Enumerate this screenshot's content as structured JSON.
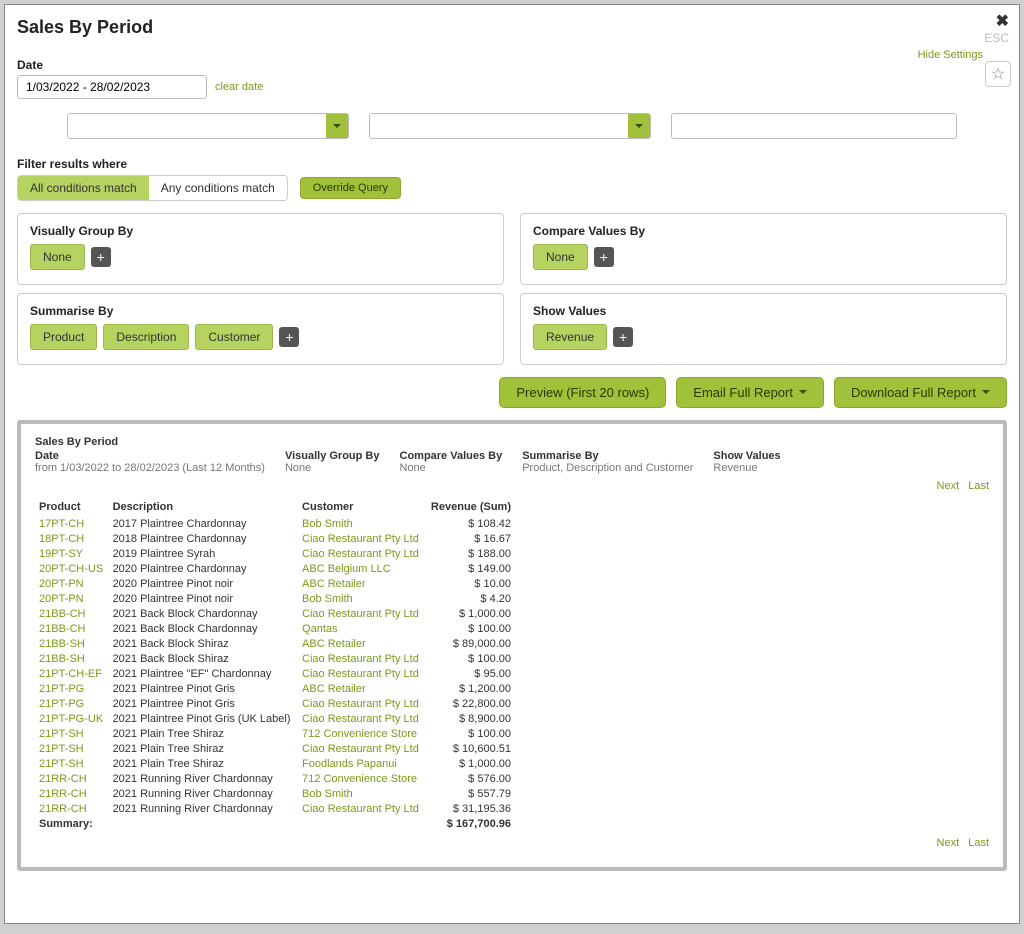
{
  "title": "Sales By Period",
  "close": "✖",
  "esc": "ESC",
  "hideSettings": "Hide Settings",
  "star": "☆",
  "dateLabel": "Date",
  "dateValue": "1/03/2022 - 28/02/2023",
  "clearDate": "clear date",
  "filterLabel": "Filter results where",
  "condAll": "All conditions match",
  "condAny": "Any conditions match",
  "override": "Override Query",
  "panels": {
    "visuallyGroupBy": {
      "title": "Visually Group By",
      "chips": [
        "None"
      ]
    },
    "compareValuesBy": {
      "title": "Compare Values By",
      "chips": [
        "None"
      ]
    },
    "summariseBy": {
      "title": "Summarise By",
      "chips": [
        "Product",
        "Description",
        "Customer"
      ]
    },
    "showValues": {
      "title": "Show Values",
      "chips": [
        "Revenue"
      ]
    }
  },
  "preview": "Preview (First 20 rows)",
  "emailReport": "Email Full Report",
  "downloadReport": "Download Full Report",
  "report": {
    "title": "Sales By Period",
    "meta": [
      {
        "label": "Date",
        "value": "from 1/03/2022 to 28/02/2023 (Last 12 Months)"
      },
      {
        "label": "Visually Group By",
        "value": "None"
      },
      {
        "label": "Compare Values By",
        "value": "None"
      },
      {
        "label": "Summarise By",
        "value": "Product, Description and Customer"
      },
      {
        "label": "Show Values",
        "value": "Revenue"
      }
    ],
    "navNext": "Next",
    "navLast": "Last",
    "headers": {
      "product": "Product",
      "description": "Description",
      "customer": "Customer",
      "revenue": "Revenue (Sum)"
    },
    "rows": [
      {
        "product": "17PT-CH",
        "description": "2017 Plaintree Chardonnay",
        "customer": "Bob Smith",
        "revenue": "$ 108.42"
      },
      {
        "product": "18PT-CH",
        "description": "2018 Plaintree Chardonnay",
        "customer": "Ciao Restaurant Pty Ltd",
        "revenue": "$ 16.67"
      },
      {
        "product": "19PT-SY",
        "description": "2019 Plaintree Syrah",
        "customer": "Ciao Restaurant Pty Ltd",
        "revenue": "$ 188.00"
      },
      {
        "product": "20PT-CH-US",
        "description": "2020 Plaintree Chardonnay",
        "customer": "ABC Belgium LLC",
        "revenue": "$ 149.00"
      },
      {
        "product": "20PT-PN",
        "description": "2020 Plaintree Pinot noir",
        "customer": "ABC Retailer",
        "revenue": "$ 10.00"
      },
      {
        "product": "20PT-PN",
        "description": "2020 Plaintree Pinot noir",
        "customer": "Bob Smith",
        "revenue": "$ 4.20"
      },
      {
        "product": "21BB-CH",
        "description": "2021 Back Block Chardonnay",
        "customer": "Ciao Restaurant Pty Ltd",
        "revenue": "$ 1,000.00"
      },
      {
        "product": "21BB-CH",
        "description": "2021 Back Block Chardonnay",
        "customer": "Qantas",
        "revenue": "$ 100.00"
      },
      {
        "product": "21BB-SH",
        "description": "2021 Back Block Shiraz",
        "customer": "ABC Retailer",
        "revenue": "$ 89,000.00"
      },
      {
        "product": "21BB-SH",
        "description": "2021 Back Block Shiraz",
        "customer": "Ciao Restaurant Pty Ltd",
        "revenue": "$ 100.00"
      },
      {
        "product": "21PT-CH-EF",
        "description": "2021 Plaintree \"EF\" Chardonnay",
        "customer": "Ciao Restaurant Pty Ltd",
        "revenue": "$ 95.00"
      },
      {
        "product": "21PT-PG",
        "description": "2021 Plaintree Pinot Gris",
        "customer": "ABC Retailer",
        "revenue": "$ 1,200.00"
      },
      {
        "product": "21PT-PG",
        "description": "2021 Plaintree Pinot Gris",
        "customer": "Ciao Restaurant Pty Ltd",
        "revenue": "$ 22,800.00"
      },
      {
        "product": "21PT-PG-UK",
        "description": "2021 Plaintree Pinot Gris (UK Label)",
        "customer": "Ciao Restaurant Pty Ltd",
        "revenue": "$ 8,900.00"
      },
      {
        "product": "21PT-SH",
        "description": "2021 Plain Tree Shiraz",
        "customer": "712 Convenience Store",
        "revenue": "$ 100.00"
      },
      {
        "product": "21PT-SH",
        "description": "2021 Plain Tree Shiraz",
        "customer": "Ciao Restaurant Pty Ltd",
        "revenue": "$ 10,600.51"
      },
      {
        "product": "21PT-SH",
        "description": "2021 Plain Tree Shiraz",
        "customer": "Foodlands Papanui",
        "revenue": "$ 1,000.00"
      },
      {
        "product": "21RR-CH",
        "description": "2021 Running River Chardonnay",
        "customer": "712 Convenience Store",
        "revenue": "$ 576.00"
      },
      {
        "product": "21RR-CH",
        "description": "2021 Running River Chardonnay",
        "customer": "Bob Smith",
        "revenue": "$ 557.79"
      },
      {
        "product": "21RR-CH",
        "description": "2021 Running River Chardonnay",
        "customer": "Ciao Restaurant Pty Ltd",
        "revenue": "$ 31,195.36"
      }
    ],
    "summaryLabel": "Summary:",
    "summaryTotal": "$ 167,700.96"
  }
}
